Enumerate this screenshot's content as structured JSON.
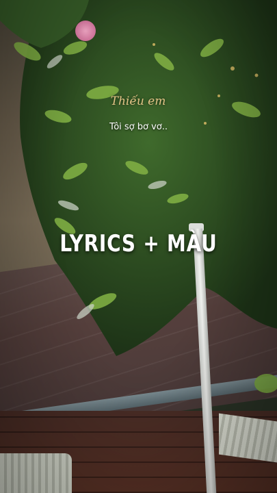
{
  "overlay": {
    "song_title": "Thiếu em",
    "lyric": "Tôi sợ bơ vơ..",
    "headline": "LYRICS + MÀU"
  },
  "colors": {
    "title_gold": "#e3c487",
    "text_white": "#ffffff",
    "foliage_dark": "#2f4a22",
    "foliage_light": "#8fbf4a"
  }
}
